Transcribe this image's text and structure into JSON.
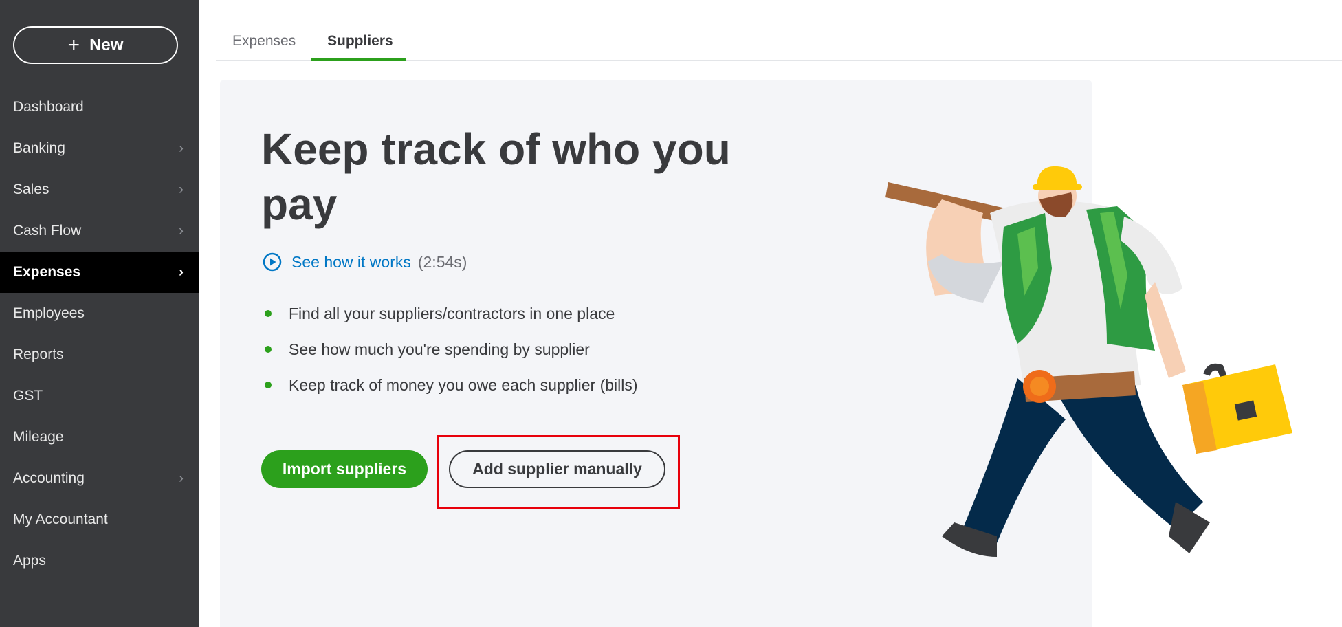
{
  "sidebar": {
    "new_button": {
      "icon": "plus-icon",
      "label": "New"
    },
    "items": [
      {
        "label": "Dashboard",
        "has_chevron": false,
        "active": false
      },
      {
        "label": "Banking",
        "has_chevron": true,
        "active": false
      },
      {
        "label": "Sales",
        "has_chevron": true,
        "active": false
      },
      {
        "label": "Cash Flow",
        "has_chevron": true,
        "active": false
      },
      {
        "label": "Expenses",
        "has_chevron": true,
        "active": true
      },
      {
        "label": "Employees",
        "has_chevron": false,
        "active": false
      },
      {
        "label": "Reports",
        "has_chevron": false,
        "active": false
      },
      {
        "label": "GST",
        "has_chevron": false,
        "active": false
      },
      {
        "label": "Mileage",
        "has_chevron": false,
        "active": false
      },
      {
        "label": "Accounting",
        "has_chevron": true,
        "active": false
      },
      {
        "label": "My Accountant",
        "has_chevron": false,
        "active": false
      },
      {
        "label": "Apps",
        "has_chevron": false,
        "active": false
      }
    ],
    "chevron_glyph": "›"
  },
  "tabs": [
    {
      "label": "Expenses",
      "active": false
    },
    {
      "label": "Suppliers",
      "active": true
    }
  ],
  "main": {
    "headline": "Keep track of who you pay",
    "video": {
      "icon": "play-circle-icon",
      "label": "See how it works",
      "duration": "(2:54s)"
    },
    "bullets": [
      "Find all your suppliers/contractors in one place",
      "See how much you're spending by supplier",
      "Keep track of money you owe each supplier (bills)"
    ],
    "import_button": "Import suppliers",
    "add_button": "Add supplier manually",
    "illustration": "worker-carrying-plank-and-toolbox-illustration"
  },
  "colors": {
    "sidebar_bg": "#393a3d",
    "active_nav_bg": "#000000",
    "accent_green": "#2ca01c",
    "link_blue": "#0077c5",
    "card_bg": "#f4f5f8",
    "highlight_red": "#e8000b"
  }
}
